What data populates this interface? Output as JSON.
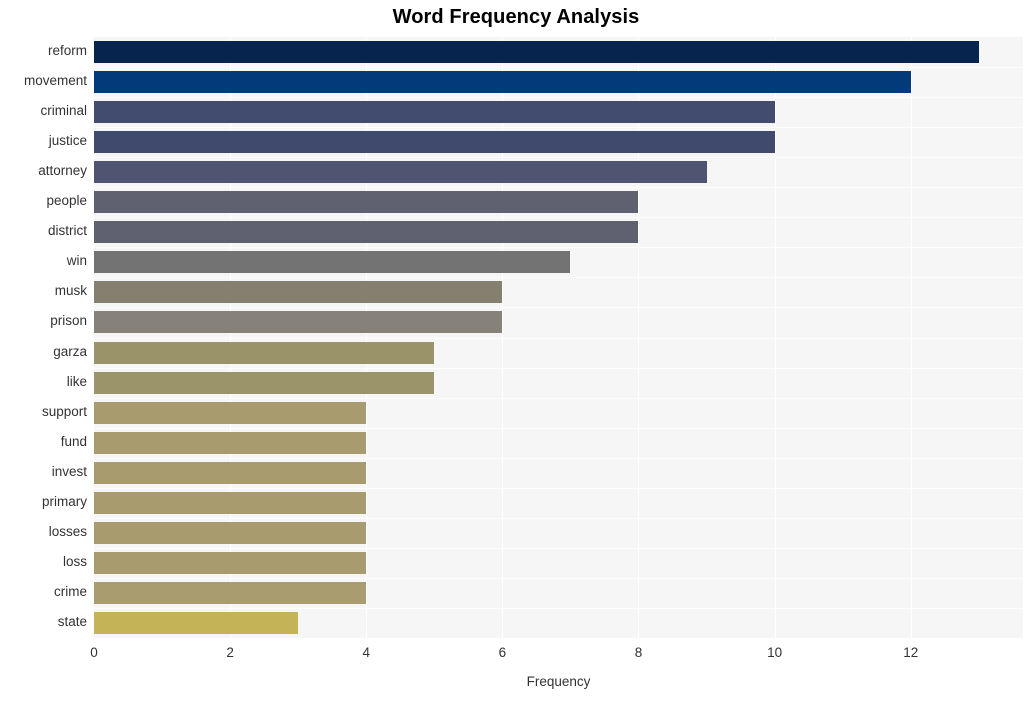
{
  "chart_data": {
    "type": "bar",
    "orientation": "horizontal",
    "title": "Word Frequency Analysis",
    "xlabel": "Frequency",
    "ylabel": "",
    "xlim": [
      0,
      13.65
    ],
    "xticks": [
      0,
      2,
      4,
      6,
      8,
      10,
      12
    ],
    "grid": "vertical",
    "legend": "none",
    "categories": [
      "reform",
      "movement",
      "criminal",
      "justice",
      "attorney",
      "people",
      "district",
      "win",
      "musk",
      "prison",
      "garza",
      "like",
      "support",
      "fund",
      "invest",
      "primary",
      "losses",
      "loss",
      "crime",
      "state"
    ],
    "values": [
      13,
      12,
      10,
      10,
      9,
      8,
      8,
      7,
      6,
      6,
      5,
      5,
      4,
      4,
      4,
      4,
      4,
      4,
      4,
      3
    ],
    "bar_colors": [
      "#06244d",
      "#023a7a",
      "#414c6f",
      "#3f4a6d",
      "#4f5570",
      "#5f6070",
      "#606170",
      "#737373",
      "#847f6f",
      "#86827a",
      "#9a9268",
      "#9b9369",
      "#a89c6f",
      "#a89c6f",
      "#a89c6f",
      "#a89c6f",
      "#a89c6f",
      "#a89c6f",
      "#a99d70",
      "#c5b358"
    ],
    "plot_background": "#f6f6f7",
    "gridline_color": "#ffffff",
    "title_color": "#000000",
    "tick_color": "#333333"
  }
}
